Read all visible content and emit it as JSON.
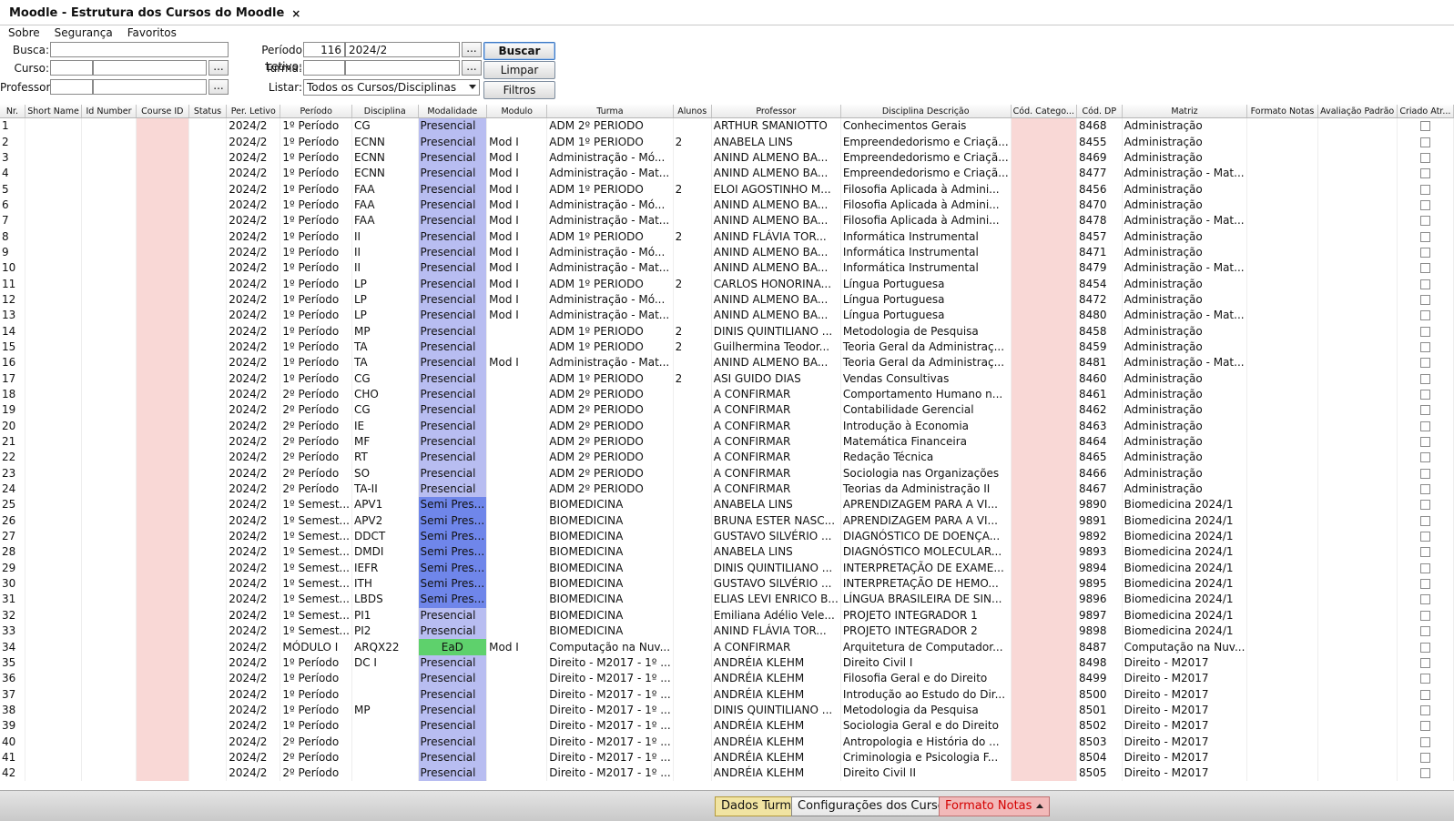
{
  "window": {
    "tab_title": "Moodle - Estrutura dos Cursos do Moodle",
    "close_glyph": "×"
  },
  "menu": [
    "Sobre",
    "Segurança",
    "Favoritos"
  ],
  "filters": {
    "busca_label": "Busca:",
    "busca_value": "",
    "periodo_label": "Período Letivo:",
    "periodo_code": "116",
    "periodo_value": "2024/2",
    "curso_label": "Curso:",
    "curso_code": "",
    "curso_value": "",
    "turma_label": "Turma:",
    "turma_code": "",
    "turma_value": "",
    "professor_label": "Professor:",
    "professor_code": "",
    "professor_value": "",
    "listar_label": "Listar:",
    "listar_value": "Todos os Cursos/Disciplinas",
    "dots": "...",
    "buscar": "Buscar",
    "limpar": "Limpar",
    "filtros": "Filtros"
  },
  "colors": {
    "pink": "#f9d8d6",
    "presencial": "#b8bdf1",
    "semi": "#6f86ea",
    "ead": "#5ed16c"
  },
  "columns": [
    "Nr.",
    "Short Name",
    "Id Number",
    "Course ID",
    "Status",
    "Per. Letivo",
    "Período",
    "Disciplina",
    "Modalidade",
    "Modulo",
    "Turma",
    "Alunos",
    "Professor",
    "Disciplina Descrição",
    "Cód. Catego...",
    "Cód. DP",
    "Matriz",
    "Formato Notas",
    "Avaliação Padrão",
    "Criado Atr..."
  ],
  "rows": [
    [
      "1",
      "2024/2",
      "1º Período",
      "CG",
      "Presencial",
      "",
      "ADM 2º PERIODO",
      "",
      "ARTHUR SMANIOTTO",
      "Conhecimentos Gerais",
      "8468",
      "Administração"
    ],
    [
      "2",
      "2024/2",
      "1º Período",
      "ECNN",
      "Presencial",
      "Mod I",
      "ADM 1º PERIODO",
      "2",
      "ANABELA LINS",
      "Empreendedorismo e Criaçã...",
      "8455",
      "Administração"
    ],
    [
      "3",
      "2024/2",
      "1º Período",
      "ECNN",
      "Presencial",
      "Mod I",
      "Administração - Mó...",
      "",
      "ANIND ALMENO BA...",
      "Empreendedorismo e Criaçã...",
      "8469",
      "Administração"
    ],
    [
      "4",
      "2024/2",
      "1º Período",
      "ECNN",
      "Presencial",
      "Mod I",
      "Administração - Mat...",
      "",
      "ANIND ALMENO BA...",
      "Empreendedorismo e Criaçã...",
      "8477",
      "Administração - Mat..."
    ],
    [
      "5",
      "2024/2",
      "1º Período",
      "FAA",
      "Presencial",
      "Mod I",
      "ADM 1º PERIODO",
      "2",
      "ELOI AGOSTINHO M...",
      "Filosofia Aplicada à Admini...",
      "8456",
      "Administração"
    ],
    [
      "6",
      "2024/2",
      "1º Período",
      "FAA",
      "Presencial",
      "Mod I",
      "Administração - Mó...",
      "",
      "ANIND ALMENO BA...",
      "Filosofia Aplicada à Admini...",
      "8470",
      "Administração"
    ],
    [
      "7",
      "2024/2",
      "1º Período",
      "FAA",
      "Presencial",
      "Mod I",
      "Administração - Mat...",
      "",
      "ANIND ALMENO BA...",
      "Filosofia Aplicada à Admini...",
      "8478",
      "Administração - Mat..."
    ],
    [
      "8",
      "2024/2",
      "1º Período",
      "II",
      "Presencial",
      "Mod I",
      "ADM 1º PERIODO",
      "2",
      "ANIND FLÁVIA TOR...",
      "Informática Instrumental",
      "8457",
      "Administração"
    ],
    [
      "9",
      "2024/2",
      "1º Período",
      "II",
      "Presencial",
      "Mod I",
      "Administração - Mó...",
      "",
      "ANIND ALMENO BA...",
      "Informática Instrumental",
      "8471",
      "Administração"
    ],
    [
      "10",
      "2024/2",
      "1º Período",
      "II",
      "Presencial",
      "Mod I",
      "Administração - Mat...",
      "",
      "ANIND ALMENO BA...",
      "Informática Instrumental",
      "8479",
      "Administração - Mat..."
    ],
    [
      "11",
      "2024/2",
      "1º Período",
      "LP",
      "Presencial",
      "Mod I",
      "ADM 1º PERIODO",
      "2",
      "CARLOS HONORINA...",
      "Língua Portuguesa",
      "8454",
      "Administração"
    ],
    [
      "12",
      "2024/2",
      "1º Período",
      "LP",
      "Presencial",
      "Mod I",
      "Administração - Mó...",
      "",
      "ANIND ALMENO BA...",
      "Língua Portuguesa",
      "8472",
      "Administração"
    ],
    [
      "13",
      "2024/2",
      "1º Período",
      "LP",
      "Presencial",
      "Mod I",
      "Administração - Mat...",
      "",
      "ANIND ALMENO BA...",
      "Língua Portuguesa",
      "8480",
      "Administração - Mat..."
    ],
    [
      "14",
      "2024/2",
      "1º Período",
      "MP",
      "Presencial",
      "",
      "ADM 1º PERIODO",
      "2",
      "DINIS QUINTILIANO ...",
      "Metodologia de Pesquisa",
      "8458",
      "Administração"
    ],
    [
      "15",
      "2024/2",
      "1º Período",
      "TA",
      "Presencial",
      "",
      "ADM 1º PERIODO",
      "2",
      "Guilhermina Teodor...",
      "Teoria Geral da Administraç...",
      "8459",
      "Administração"
    ],
    [
      "16",
      "2024/2",
      "1º Período",
      "TA",
      "Presencial",
      "Mod I",
      "Administração - Mat...",
      "",
      "ANIND ALMENO BA...",
      "Teoria Geral da Administraç...",
      "8481",
      "Administração - Mat..."
    ],
    [
      "17",
      "2024/2",
      "1º Período",
      "CG",
      "Presencial",
      "",
      "ADM 1º PERIODO",
      "2",
      "ASI GUIDO DIAS",
      "Vendas Consultivas",
      "8460",
      "Administração"
    ],
    [
      "18",
      "2024/2",
      "2º Período",
      "CHO",
      "Presencial",
      "",
      "ADM 2º PERIODO",
      "",
      "A CONFIRMAR",
      "Comportamento Humano n...",
      "8461",
      "Administração"
    ],
    [
      "19",
      "2024/2",
      "2º Período",
      "CG",
      "Presencial",
      "",
      "ADM 2º PERIODO",
      "",
      "A CONFIRMAR",
      "Contabilidade Gerencial",
      "8462",
      "Administração"
    ],
    [
      "20",
      "2024/2",
      "2º Período",
      "IE",
      "Presencial",
      "",
      "ADM 2º PERIODO",
      "",
      "A CONFIRMAR",
      "Introdução à Economia",
      "8463",
      "Administração"
    ],
    [
      "21",
      "2024/2",
      "2º Período",
      "MF",
      "Presencial",
      "",
      "ADM 2º PERIODO",
      "",
      "A CONFIRMAR",
      "Matemática Financeira",
      "8464",
      "Administração"
    ],
    [
      "22",
      "2024/2",
      "2º Período",
      "RT",
      "Presencial",
      "",
      "ADM 2º PERIODO",
      "",
      "A CONFIRMAR",
      "Redação Técnica",
      "8465",
      "Administração"
    ],
    [
      "23",
      "2024/2",
      "2º Período",
      "SO",
      "Presencial",
      "",
      "ADM 2º PERIODO",
      "",
      "A CONFIRMAR",
      "Sociologia nas Organizações",
      "8466",
      "Administração"
    ],
    [
      "24",
      "2024/2",
      "2º Período",
      "TA-II",
      "Presencial",
      "",
      "ADM 2º PERIODO",
      "",
      "A CONFIRMAR",
      "Teorias da Administração II",
      "8467",
      "Administração"
    ],
    [
      "25",
      "2024/2",
      "1º Semest...",
      "APV1",
      "Semi Pres...",
      "",
      "BIOMEDICINA",
      "",
      "ANABELA LINS",
      "APRENDIZAGEM PARA A VI...",
      "9890",
      "Biomedicina 2024/1"
    ],
    [
      "26",
      "2024/2",
      "1º Semest...",
      "APV2",
      "Semi Pres...",
      "",
      "BIOMEDICINA",
      "",
      "BRUNA ESTER NASC...",
      "APRENDIZAGEM PARA A VI...",
      "9891",
      "Biomedicina 2024/1"
    ],
    [
      "27",
      "2024/2",
      "1º Semest...",
      "DDCT",
      "Semi Pres...",
      "",
      "BIOMEDICINA",
      "",
      "GUSTAVO SILVÉRIO ...",
      "DIAGNÓSTICO DE DOENÇA...",
      "9892",
      "Biomedicina 2024/1"
    ],
    [
      "28",
      "2024/2",
      "1º Semest...",
      "DMDI",
      "Semi Pres...",
      "",
      "BIOMEDICINA",
      "",
      "ANABELA LINS",
      "DIAGNÓSTICO MOLECULAR...",
      "9893",
      "Biomedicina 2024/1"
    ],
    [
      "29",
      "2024/2",
      "1º Semest...",
      "IEFR",
      "Semi Pres...",
      "",
      "BIOMEDICINA",
      "",
      "DINIS QUINTILIANO ...",
      "INTERPRETAÇÃO DE EXAME...",
      "9894",
      "Biomedicina 2024/1"
    ],
    [
      "30",
      "2024/2",
      "1º Semest...",
      "ITH",
      "Semi Pres...",
      "",
      "BIOMEDICINA",
      "",
      "GUSTAVO SILVÉRIO ...",
      "INTERPRETAÇÃO DE HEMO...",
      "9895",
      "Biomedicina 2024/1"
    ],
    [
      "31",
      "2024/2",
      "1º Semest...",
      "LBDS",
      "Semi Pres...",
      "",
      "BIOMEDICINA",
      "",
      "ELIAS LEVI ENRICO B...",
      "LÍNGUA BRASILEIRA DE SIN...",
      "9896",
      "Biomedicina 2024/1"
    ],
    [
      "32",
      "2024/2",
      "1º Semest...",
      "PI1",
      "Presencial",
      "",
      "BIOMEDICINA",
      "",
      "Emiliana Adélio Vele...",
      "PROJETO INTEGRADOR 1",
      "9897",
      "Biomedicina 2024/1"
    ],
    [
      "33",
      "2024/2",
      "1º Semest...",
      "PI2",
      "Presencial",
      "",
      "BIOMEDICINA",
      "",
      "ANIND FLÁVIA TOR...",
      "PROJETO INTEGRADOR 2",
      "9898",
      "Biomedicina 2024/1"
    ],
    [
      "34",
      "2024/2",
      "MÓDULO I",
      "ARQX22",
      "EaD",
      "Mod I",
      "Computação na Nuv...",
      "",
      "A CONFIRMAR",
      "Arquitetura de Computador...",
      "8487",
      "Computação na Nuv..."
    ],
    [
      "35",
      "2024/2",
      "1º Período",
      "DC I",
      "Presencial",
      "",
      "Direito - M2017 - 1º ...",
      "",
      "ANDRÉIA KLEHM",
      "Direito Civil I",
      "8498",
      "Direito - M2017"
    ],
    [
      "36",
      "2024/2",
      "1º Período",
      "",
      "Presencial",
      "",
      "Direito - M2017 - 1º ...",
      "",
      "ANDRÉIA KLEHM",
      "Filosofia Geral e do Direito",
      "8499",
      "Direito - M2017"
    ],
    [
      "37",
      "2024/2",
      "1º Período",
      "",
      "Presencial",
      "",
      "Direito - M2017 - 1º ...",
      "",
      "ANDRÉIA KLEHM",
      "Introdução ao Estudo do Dir...",
      "8500",
      "Direito - M2017"
    ],
    [
      "38",
      "2024/2",
      "1º Período",
      "MP",
      "Presencial",
      "",
      "Direito - M2017 - 1º ...",
      "",
      "DINIS QUINTILIANO ...",
      "Metodologia da Pesquisa",
      "8501",
      "Direito - M2017"
    ],
    [
      "39",
      "2024/2",
      "1º Período",
      "",
      "Presencial",
      "",
      "Direito - M2017 - 1º ...",
      "",
      "ANDRÉIA KLEHM",
      "Sociologia Geral e do Direito",
      "8502",
      "Direito - M2017"
    ],
    [
      "40",
      "2024/2",
      "2º Período",
      "",
      "Presencial",
      "",
      "Direito - M2017 - 1º ...",
      "",
      "ANDRÉIA KLEHM",
      "Antropologia e História do ...",
      "8503",
      "Direito - M2017"
    ],
    [
      "41",
      "2024/2",
      "2º Período",
      "",
      "Presencial",
      "",
      "Direito - M2017 - 1º ...",
      "",
      "ANDRÉIA KLEHM",
      "Criminologia e Psicologia F...",
      "8504",
      "Direito - M2017"
    ],
    [
      "42",
      "2024/2",
      "2º Período",
      "",
      "Presencial",
      "",
      "Direito - M2017 - 1º ...",
      "",
      "ANDRÉIA KLEHM",
      "Direito Civil II",
      "8505",
      "Direito - M2017"
    ]
  ],
  "bottom": {
    "dados_turma": "Dados Turma",
    "config_cursos": "Configurações dos Cursos",
    "formato_notas": "Formato Notas"
  }
}
